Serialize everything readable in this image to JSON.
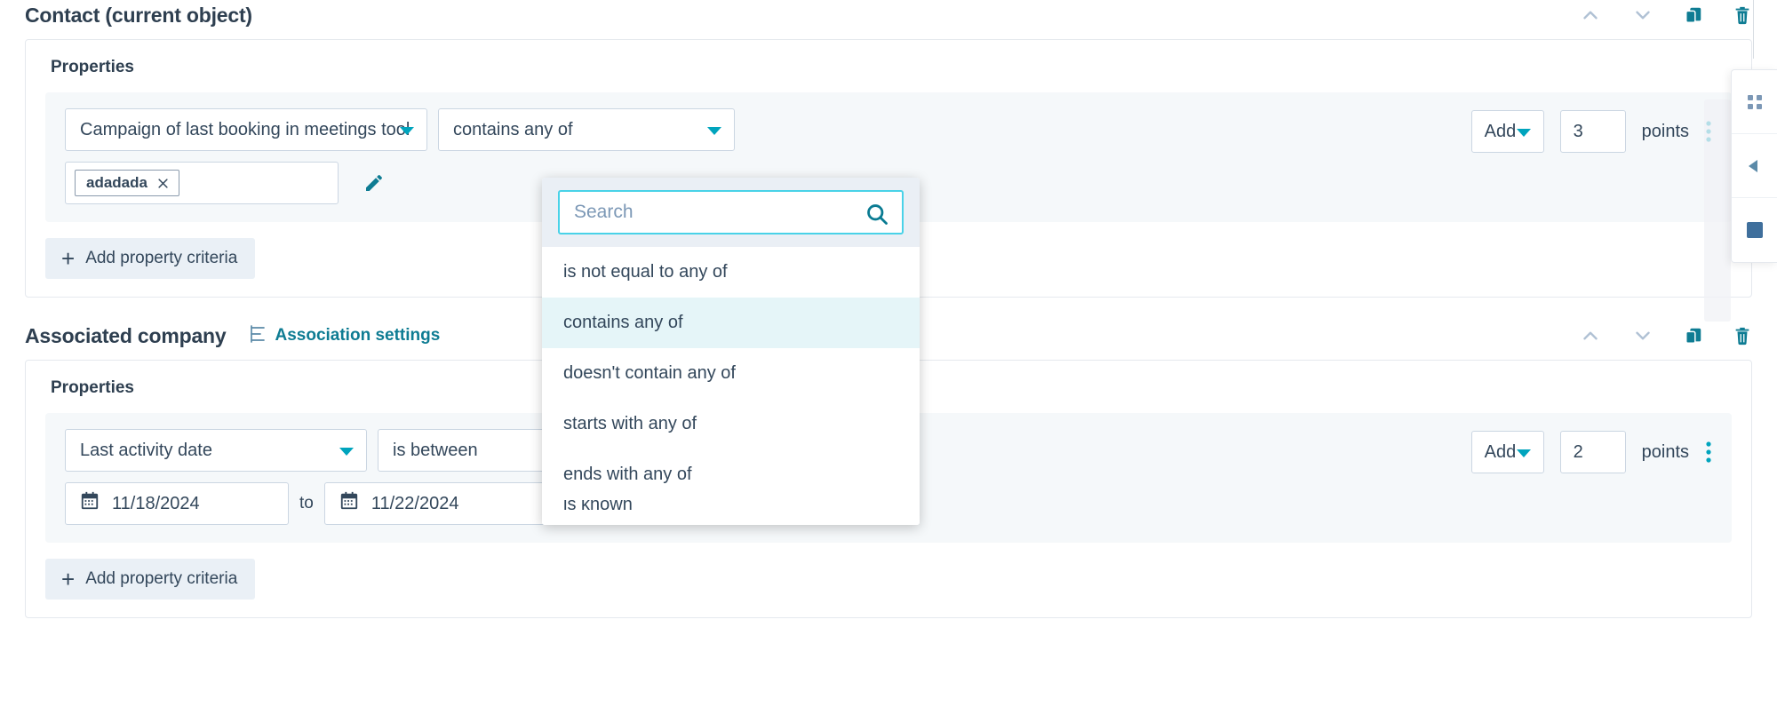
{
  "colors": {
    "accent_teal": "#00a4bd",
    "link_teal": "#0e7c93",
    "text_dark": "#2e3f50",
    "text_body": "#33475b",
    "border": "#cbd6e2",
    "panel_bg": "#f5f8fa",
    "highlight": "#e5f5f8",
    "focus_ring": "#49d2e8"
  },
  "sections": [
    {
      "title": "Contact (current object)",
      "card_label": "Properties",
      "property_select": "Campaign of last booking in meetings tool",
      "operator_select": "contains any of",
      "tags": [
        "adadada"
      ],
      "add_criteria_label": "Add property criteria",
      "score": {
        "operation": "Add",
        "points_value": "3",
        "points_label": "points"
      },
      "header_icons": [
        "chevron-up-icon",
        "chevron-down-icon",
        "duplicate-icon",
        "delete-icon"
      ]
    },
    {
      "title": "Associated company",
      "association_settings_label": "Association settings",
      "card_label": "Properties",
      "property_select": "Last activity date",
      "operator_select": "is between",
      "date_from": "11/18/2024",
      "date_to": "11/22/2024",
      "to_label": "to",
      "add_criteria_label": "Add property criteria",
      "score": {
        "operation": "Add",
        "points_value": "2",
        "points_label": "points"
      },
      "header_icons": [
        "chevron-up-icon",
        "chevron-down-icon",
        "duplicate-icon",
        "delete-icon"
      ]
    }
  ],
  "dropdown": {
    "search_placeholder": "Search",
    "options": [
      "is not equal to any of",
      "contains any of",
      "doesn't contain any of",
      "starts with any of",
      "ends with any of",
      "is known"
    ],
    "selected": "contains any of"
  }
}
